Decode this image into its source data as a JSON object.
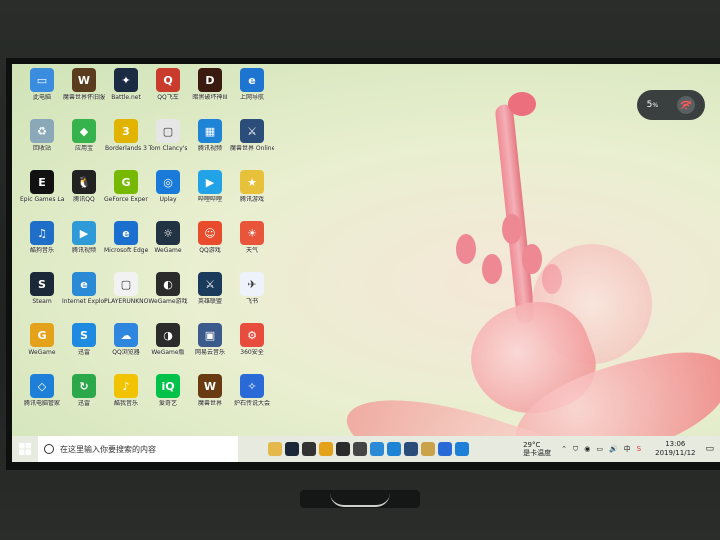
{
  "desktop": {
    "icons": [
      {
        "label": "此电脑",
        "color": "#3a8dde",
        "glyph": "▭"
      },
      {
        "label": "魔兽世界怀旧服",
        "color": "#5a3d1e",
        "glyph": "W"
      },
      {
        "label": "Battle.net",
        "color": "#1b2b44",
        "glyph": "✦"
      },
      {
        "label": "QQ飞车",
        "color": "#c93b2d",
        "glyph": "Q"
      },
      {
        "label": "暗黑破坏神III",
        "color": "#3b1a10",
        "glyph": "D"
      },
      {
        "label": "上网导航",
        "color": "#1e74d1",
        "glyph": "e"
      },
      {
        "label": "回收站",
        "color": "#8aa8b8",
        "glyph": "♻"
      },
      {
        "label": "应用宝",
        "color": "#36b34c",
        "glyph": "◆"
      },
      {
        "label": "Borderlands 3",
        "color": "#e0b400",
        "glyph": "3"
      },
      {
        "label": "Tom Clancy's",
        "color": "#e6e6e6",
        "glyph": "▢"
      },
      {
        "label": "腾讯视频",
        "color": "#1f84d6",
        "glyph": "▦"
      },
      {
        "label": "魔兽世界 Online",
        "color": "#2b4d7a",
        "glyph": "⚔"
      },
      {
        "label": "Epic Games Launcher",
        "color": "#111111",
        "glyph": "E"
      },
      {
        "label": "腾讯QQ",
        "color": "#222222",
        "glyph": "🐧"
      },
      {
        "label": "GeForce Experience",
        "color": "#76b900",
        "glyph": "G"
      },
      {
        "label": "Uplay",
        "color": "#1a7ad9",
        "glyph": "◎"
      },
      {
        "label": "哔哩哔哩",
        "color": "#22a3e8",
        "glyph": "▶"
      },
      {
        "label": "腾讯游戏",
        "color": "#e8c13a",
        "glyph": "★"
      },
      {
        "label": "酷狗音乐",
        "color": "#1f6fc9",
        "glyph": "♫"
      },
      {
        "label": "腾讯视频",
        "color": "#2e9bd8",
        "glyph": "▶"
      },
      {
        "label": "Microsoft Edge",
        "color": "#1b6fcf",
        "glyph": "e"
      },
      {
        "label": "WeGame",
        "color": "#223344",
        "glyph": "☼"
      },
      {
        "label": "QQ游戏",
        "color": "#e94c2c",
        "glyph": "☺"
      },
      {
        "label": "天气",
        "color": "#e8553a",
        "glyph": "☀"
      },
      {
        "label": "Steam",
        "color": "#1b2838",
        "glyph": "S"
      },
      {
        "label": "Internet Explorer",
        "color": "#2a8ad6",
        "glyph": "e"
      },
      {
        "label": "PLAYERUNKNOWN'S BATTLEGROUNDS",
        "color": "#f2f2f2",
        "glyph": "▢"
      },
      {
        "label": "WeGame游戏",
        "color": "#2b2b2b",
        "glyph": "◐"
      },
      {
        "label": "英雄联盟",
        "color": "#1a3b5c",
        "glyph": "⚔"
      },
      {
        "label": "飞书",
        "color": "#eef3fb",
        "glyph": "✈"
      },
      {
        "label": "WeGame",
        "color": "#e3a21a",
        "glyph": "G"
      },
      {
        "label": "迅雷",
        "color": "#1e8be0",
        "glyph": "S"
      },
      {
        "label": "QQ浏览器",
        "color": "#2e86de",
        "glyph": "☁"
      },
      {
        "label": "WeGame版",
        "color": "#2b2b2b",
        "glyph": "◑"
      },
      {
        "label": "网易云音乐",
        "color": "#3b5b8c",
        "glyph": "▣"
      },
      {
        "label": "360安全",
        "color": "#e84c3d",
        "glyph": "⚙"
      },
      {
        "label": "腾讯电脑管家",
        "color": "#1e7fd9",
        "glyph": "◇"
      },
      {
        "label": "迅雷",
        "color": "#2aa84a",
        "glyph": "↻"
      },
      {
        "label": "酷我音乐",
        "color": "#f2c300",
        "glyph": "♪"
      },
      {
        "label": "爱奇艺",
        "color": "#00c24a",
        "glyph": "iQ"
      },
      {
        "label": "魔兽世界",
        "color": "#6a3b12",
        "glyph": "W"
      },
      {
        "label": "炉石传说大会",
        "color": "#2a6ad6",
        "glyph": "✧"
      }
    ]
  },
  "widget": {
    "number": "5",
    "unit": "%"
  },
  "taskbar": {
    "search_placeholder": "在这里输入你要搜索的内容",
    "weather_temp": "29°C",
    "weather_desc": "是卡温度",
    "ime": "中",
    "time": "13:06",
    "date": "2019/11/12"
  }
}
